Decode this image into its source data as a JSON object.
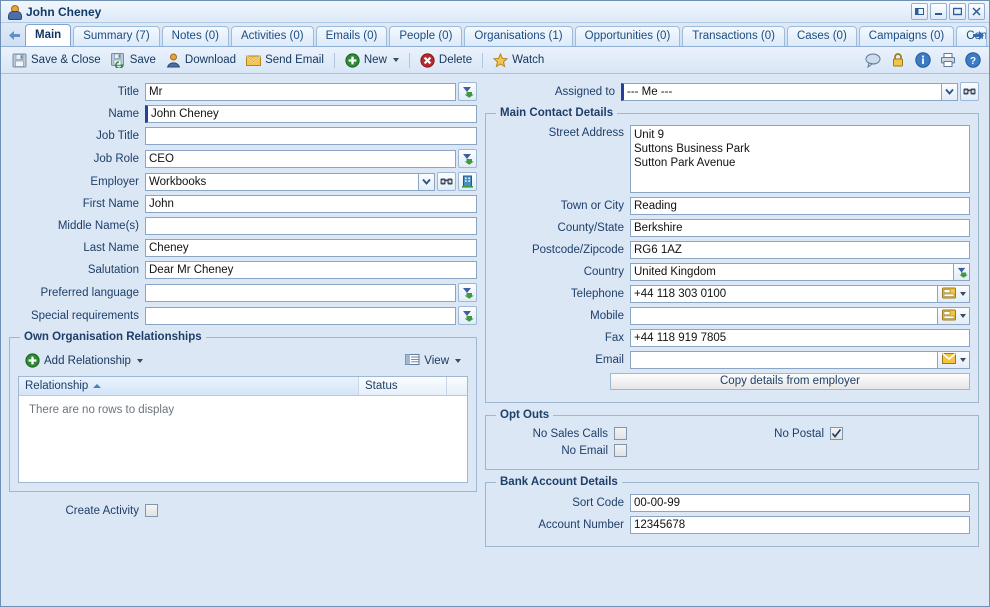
{
  "window": {
    "title": "John Cheney",
    "buttons": [
      {
        "name": "dock-button",
        "label": "dock"
      },
      {
        "name": "minimize-button",
        "label": "minimize"
      },
      {
        "name": "maximize-button",
        "label": "maximize"
      },
      {
        "name": "close-button",
        "label": "close"
      }
    ]
  },
  "tabs": {
    "scroll_left": "scroll-left",
    "scroll_right": "scroll-right",
    "items": [
      {
        "label": "Main",
        "active": true
      },
      {
        "label": "Summary (7)",
        "active": false
      },
      {
        "label": "Notes (0)",
        "active": false
      },
      {
        "label": "Activities (0)",
        "active": false
      },
      {
        "label": "Emails (0)",
        "active": false
      },
      {
        "label": "People (0)",
        "active": false
      },
      {
        "label": "Organisations (1)",
        "active": false
      },
      {
        "label": "Opportunities (0)",
        "active": false
      },
      {
        "label": "Transactions (0)",
        "active": false
      },
      {
        "label": "Cases (0)",
        "active": false
      },
      {
        "label": "Campaigns (0)",
        "active": false
      },
      {
        "label": "Conta",
        "active": false
      }
    ]
  },
  "toolbar": {
    "save_close": "Save & Close",
    "save": "Save",
    "download": "Download",
    "send_email": "Send Email",
    "new": "New",
    "delete": "Delete",
    "watch": "Watch",
    "right_icons": [
      "comment-icon",
      "lock-icon",
      "info-icon",
      "print-icon",
      "help-icon"
    ]
  },
  "left": {
    "title": {
      "label": "Title",
      "value": "Mr"
    },
    "name": {
      "label": "Name",
      "value": "John Cheney"
    },
    "job_title": {
      "label": "Job Title",
      "value": ""
    },
    "job_role": {
      "label": "Job Role",
      "value": "CEO"
    },
    "employer": {
      "label": "Employer",
      "value": "Workbooks"
    },
    "first_name": {
      "label": "First Name",
      "value": "John"
    },
    "middle_names": {
      "label": "Middle Name(s)",
      "value": ""
    },
    "last_name": {
      "label": "Last Name",
      "value": "Cheney"
    },
    "salutation": {
      "label": "Salutation",
      "value": "Dear Mr Cheney"
    },
    "preferred_language": {
      "label": "Preferred language",
      "value": ""
    },
    "special_requirements": {
      "label": "Special requirements",
      "value": ""
    },
    "relationships": {
      "legend": "Own Organisation Relationships",
      "add_button": "Add Relationship",
      "view_button": "View",
      "columns": [
        "Relationship",
        "Status",
        ""
      ],
      "empty_text": "There are no rows to display",
      "sorted_column": "Relationship",
      "sort_direction": "ascending"
    },
    "create_activity": {
      "label": "Create Activity",
      "checked": false
    }
  },
  "right": {
    "assigned_to": {
      "label": "Assigned to",
      "value": "--- Me ---"
    },
    "main_contact_details": {
      "legend": "Main Contact Details",
      "street_address": {
        "label": "Street Address",
        "value": "Unit 9\nSuttons Business Park\nSutton Park Avenue"
      },
      "town": {
        "label": "Town or City",
        "value": "Reading"
      },
      "county": {
        "label": "County/State",
        "value": "Berkshire"
      },
      "postcode": {
        "label": "Postcode/Zipcode",
        "value": "RG6 1AZ"
      },
      "country": {
        "label": "Country",
        "value": "United Kingdom"
      },
      "telephone": {
        "label": "Telephone",
        "value": "+44 118 303 0100"
      },
      "mobile": {
        "label": "Mobile",
        "value": ""
      },
      "fax": {
        "label": "Fax",
        "value": "+44 118 919 7805"
      },
      "email": {
        "label": "Email",
        "value": ""
      },
      "copy_button": "Copy details from employer"
    },
    "opt_outs": {
      "legend": "Opt Outs",
      "no_sales_calls": {
        "label": "No Sales Calls",
        "checked": false
      },
      "no_email": {
        "label": "No Email",
        "checked": false
      },
      "no_postal": {
        "label": "No Postal",
        "checked": true
      }
    },
    "bank": {
      "legend": "Bank Account Details",
      "sort_code": {
        "label": "Sort Code",
        "value": "00-00-99"
      },
      "account_number": {
        "label": "Account Number",
        "value": "12345678"
      }
    }
  },
  "colors": {
    "accent": "#1d3f68",
    "mandatory": "#25409a",
    "window_bg": "#dce7f6",
    "field_border": "#8aa6c4"
  }
}
